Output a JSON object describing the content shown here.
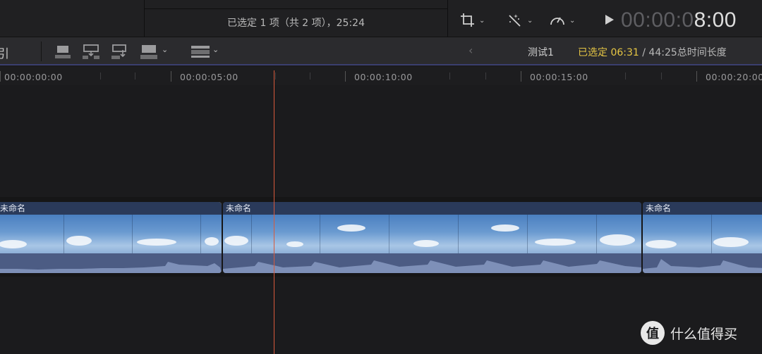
{
  "top": {
    "selection_summary": "已选定 1 项（共 2 项），25:24",
    "timecode_dim": "00:00:0",
    "timecode_bright": "8:00",
    "tools": [
      {
        "icon": "crop-icon"
      },
      {
        "icon": "magic-wand-icon"
      },
      {
        "icon": "speedometer-icon"
      }
    ]
  },
  "toolbar": {
    "left_stub": "引",
    "edit_icons": [
      "connect-clip-icon",
      "insert-clip-icon",
      "append-clip-icon",
      "overwrite-clip-icon",
      "clip-appearance-icon"
    ],
    "back_glyph": "‹",
    "project_name": "测试1",
    "selected_prefix": "已选定 ",
    "selected_duration": "06:31",
    "total_text": " / 44:25总时间长度"
  },
  "ruler": {
    "labels": [
      "00:00:00:00",
      "00:00:05:00",
      "00:00:10:00",
      "00:00:15:00",
      "00:00:20:00"
    ]
  },
  "clips": [
    {
      "name": "未命名",
      "selected": true
    },
    {
      "name": "未命名",
      "selected": false
    },
    {
      "name": "未命名",
      "selected": false
    }
  ],
  "watermark": {
    "badge": "值",
    "text": "什么值得买"
  },
  "colors": {
    "playhead": "#d75a3c",
    "selection": "#f0c94a",
    "duration_highlight": "#e6c644"
  }
}
